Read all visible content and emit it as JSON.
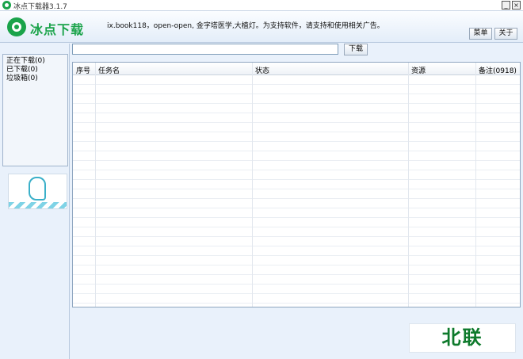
{
  "window": {
    "title": "冰点下载器3.1.7",
    "minimize_glyph": "_",
    "close_glyph": "×"
  },
  "header": {
    "logo_text": "冰点下载",
    "marquee": "ix.book118，open-open, 金字塔医学,大植灯。为支持软件，请支持和使用相关广告。",
    "menu_label": "菜单",
    "about_label": "关于"
  },
  "sidebar": {
    "items": [
      {
        "label": "正在下载(0)"
      },
      {
        "label": "已下载(0)"
      },
      {
        "label": "垃圾箱(0)"
      }
    ]
  },
  "search": {
    "value": "",
    "download_label": "下载"
  },
  "table": {
    "columns": [
      "序号",
      "任务名",
      "状态",
      "资源",
      "备注(0918)"
    ],
    "rows": []
  },
  "brand": {
    "text": "北联"
  },
  "colors": {
    "accent": "#1aa34a",
    "brand_green": "#0e7a2c",
    "panel": "#e9f1fb"
  }
}
